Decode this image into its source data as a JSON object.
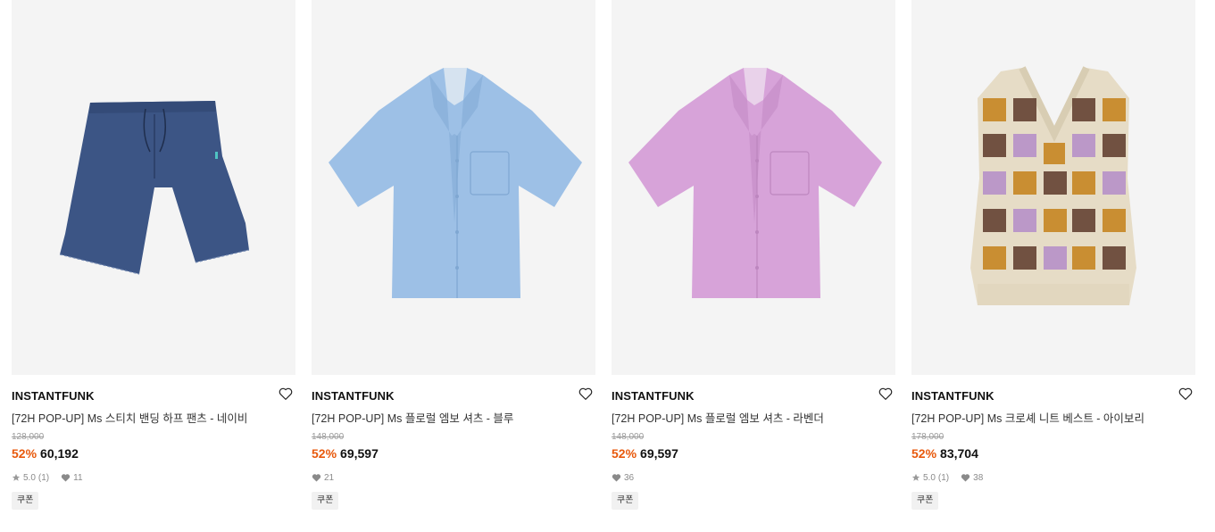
{
  "colors": {
    "discount": "#e8590c",
    "image_bg": "#f4f4f4",
    "tag_bg": "#f1f1f1"
  },
  "products": [
    {
      "brand": "INSTANTFUNK",
      "name": "[72H POP-UP] Ms 스티치 밴딩 하프 팬츠 - 네이비",
      "original_price": "128,000",
      "discount": "52%",
      "price": "60,192",
      "rating": "5.0",
      "review_count": "(1)",
      "likes": "11",
      "tag": "쿠폰",
      "image": "navy-denim-shorts"
    },
    {
      "brand": "INSTANTFUNK",
      "name": "[72H POP-UP] Ms 플로럴 엠보 셔츠 - 블루",
      "original_price": "148,000",
      "discount": "52%",
      "price": "69,597",
      "likes": "21",
      "tag": "쿠폰",
      "image": "blue-short-sleeve-shirt"
    },
    {
      "brand": "INSTANTFUNK",
      "name": "[72H POP-UP] Ms 플로럴 엠보 셔츠 - 라벤더",
      "original_price": "148,000",
      "discount": "52%",
      "price": "69,597",
      "likes": "36",
      "tag": "쿠폰",
      "image": "lavender-short-sleeve-shirt"
    },
    {
      "brand": "INSTANTFUNK",
      "name": "[72H POP-UP] Ms 크로셰 니트 베스트 - 아이보리",
      "original_price": "178,000",
      "discount": "52%",
      "price": "83,704",
      "rating": "5.0",
      "review_count": "(1)",
      "likes": "38",
      "tag": "쿠폰",
      "image": "ivory-crochet-knit-vest"
    }
  ]
}
